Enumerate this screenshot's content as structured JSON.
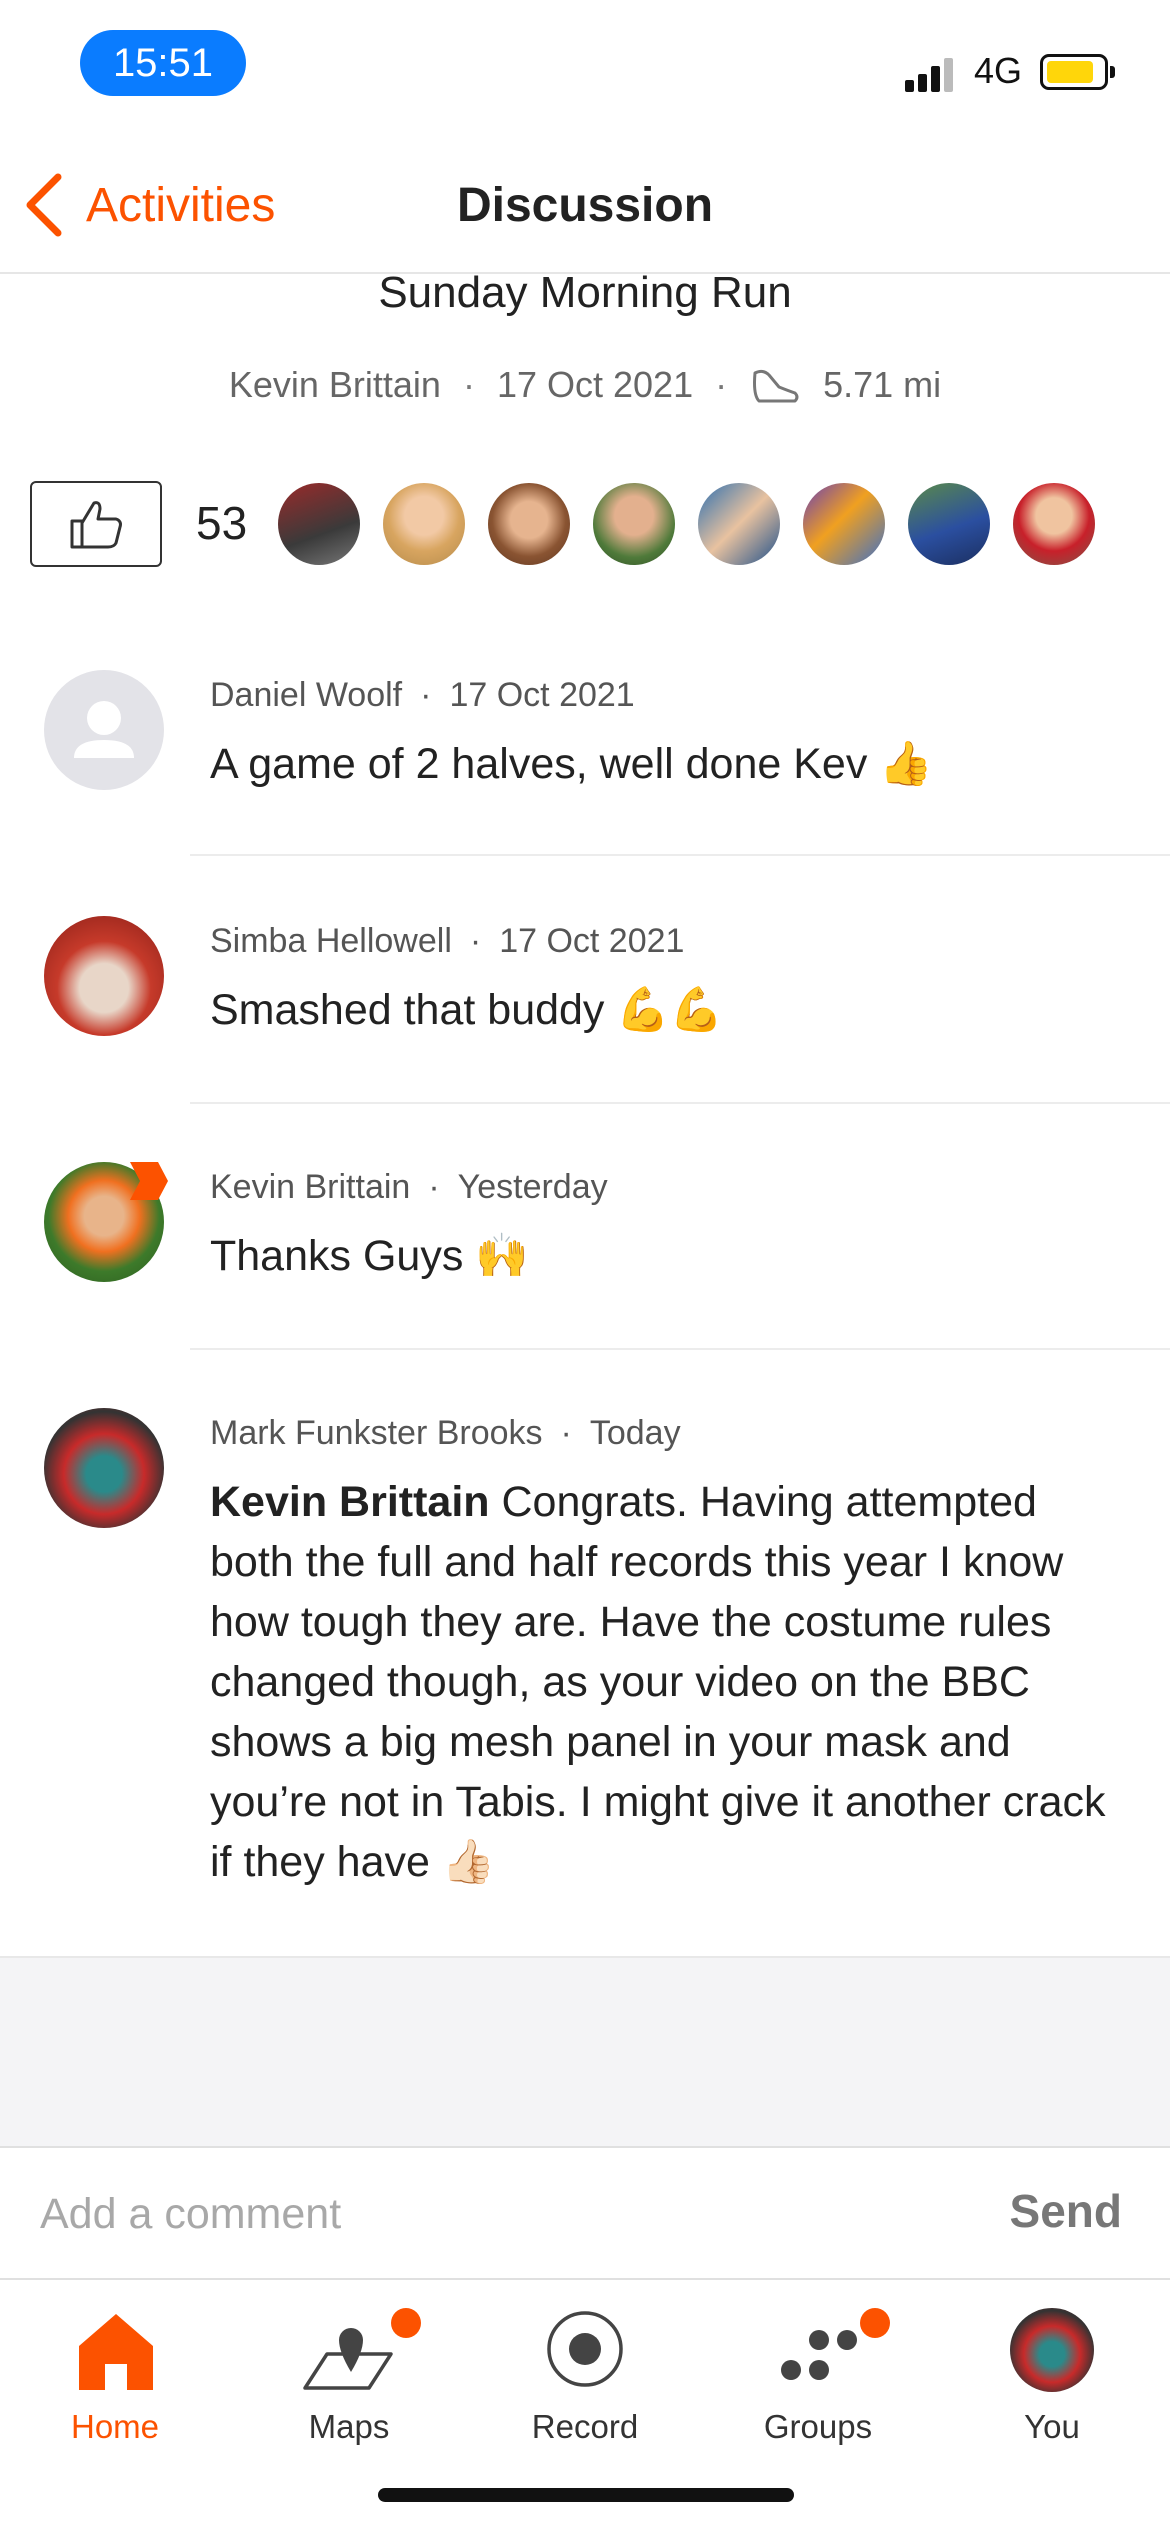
{
  "status_bar": {
    "time": "15:51",
    "network": "4G",
    "battery_level": 0.85
  },
  "nav": {
    "back_label": "Activities",
    "title": "Discussion"
  },
  "activity": {
    "title": "Sunday Morning Run",
    "athlete": "Kevin Brittain",
    "date": "17 Oct 2021",
    "distance": "5.71 mi"
  },
  "kudos": {
    "count": "53"
  },
  "comments": [
    {
      "author": "Daniel Woolf",
      "time": "17 Oct 2021",
      "text": "A game of 2 halves, well done Kev 👍"
    },
    {
      "author": "Simba Hellowell",
      "time": "17 Oct 2021",
      "text": "Smashed that buddy 💪💪"
    },
    {
      "author": "Kevin Brittain",
      "time": "Yesterday",
      "text": "Thanks Guys 🙌"
    },
    {
      "author": "Mark Funkster Brooks",
      "time": "Today",
      "mention": "Kevin Brittain",
      "text": " Congrats. Having attempted both the full and half records this year I know how tough they are. Have the costume rules changed though, as your video on the BBC shows a big mesh panel in your mask and you’re not in Tabis. I might give it another crack if they have 👍🏻"
    }
  ],
  "comment_bar": {
    "placeholder": "Add a comment",
    "send_label": "Send"
  },
  "tabbar": {
    "items": [
      {
        "label": "Home",
        "icon": "home-icon"
      },
      {
        "label": "Maps",
        "icon": "map-icon"
      },
      {
        "label": "Record",
        "icon": "record-icon"
      },
      {
        "label": "Groups",
        "icon": "groups-icon"
      },
      {
        "label": "You",
        "icon": "profile-avatar"
      }
    ]
  },
  "colors": {
    "accent": "#fc5200",
    "time_pill": "#0a7cff",
    "battery": "#ffd60a"
  }
}
